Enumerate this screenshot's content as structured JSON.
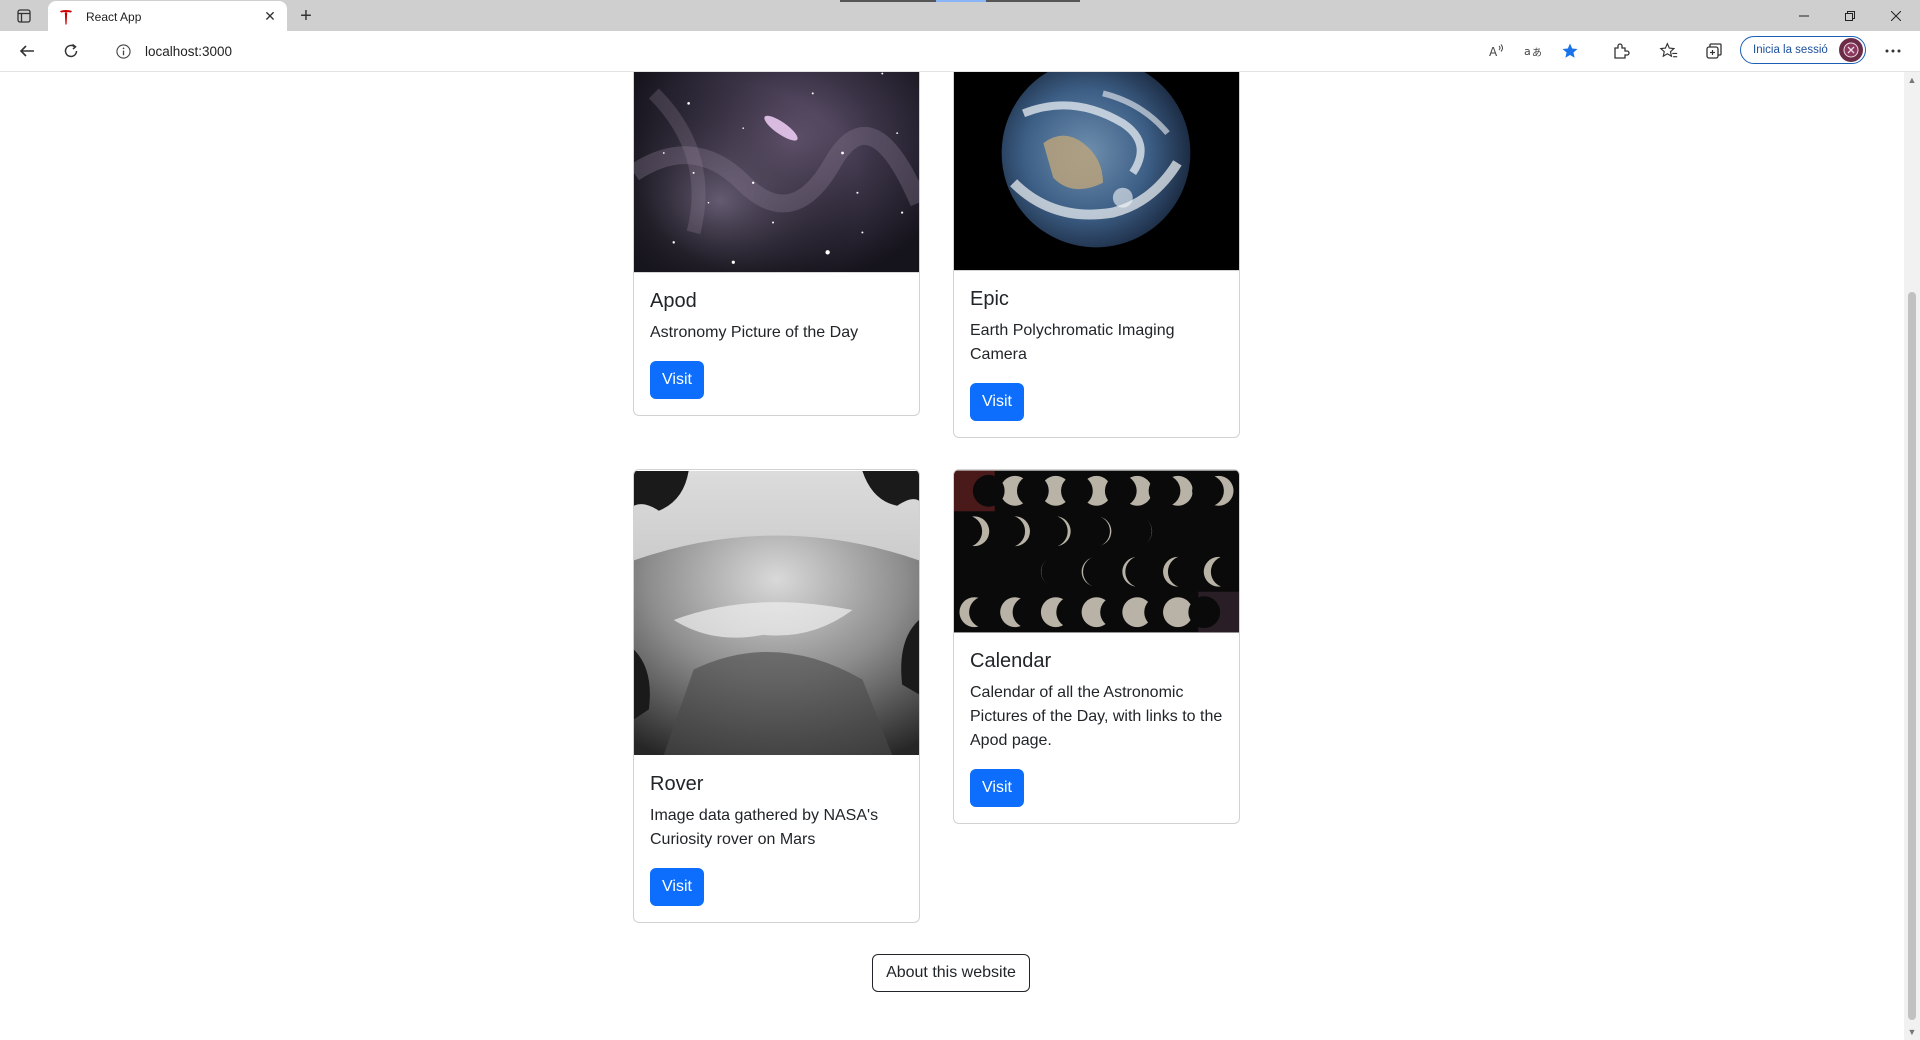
{
  "browser": {
    "tab_title": "React App",
    "url": "localhost:3000",
    "signin_label": "Inicia la sessió",
    "new_tab_glyph": "+",
    "close_glyph": "✕"
  },
  "icons": {
    "tab_actions": "tab-actions-icon",
    "favicon": "tesla-logo-icon",
    "back": "back-arrow-icon",
    "refresh": "refresh-icon",
    "info": "info-icon",
    "read_aloud": "read-aloud-icon",
    "translate": "translate-icon",
    "favorite": "star-filled-icon",
    "extensions": "extensions-icon",
    "favorites": "favorites-icon",
    "collections": "collections-icon",
    "more": "more-icon"
  },
  "colors": {
    "primary": "#0d6efd",
    "favicon": "#cc0000",
    "star": "#1a73e8"
  },
  "cards": [
    {
      "title": "Apod",
      "text": "Astronomy Picture of the Day",
      "button": "Visit"
    },
    {
      "title": "Epic",
      "text": "Earth Polychromatic Imaging Camera",
      "button": "Visit"
    },
    {
      "title": "Rover",
      "text": "Image data gathered by NASA's Curiosity rover on Mars",
      "button": "Visit"
    },
    {
      "title": "Calendar",
      "text": "Calendar of all the Astronomic Pictures of the Day, with links to the Apod page.",
      "button": "Visit"
    }
  ],
  "about_label": "About this website"
}
